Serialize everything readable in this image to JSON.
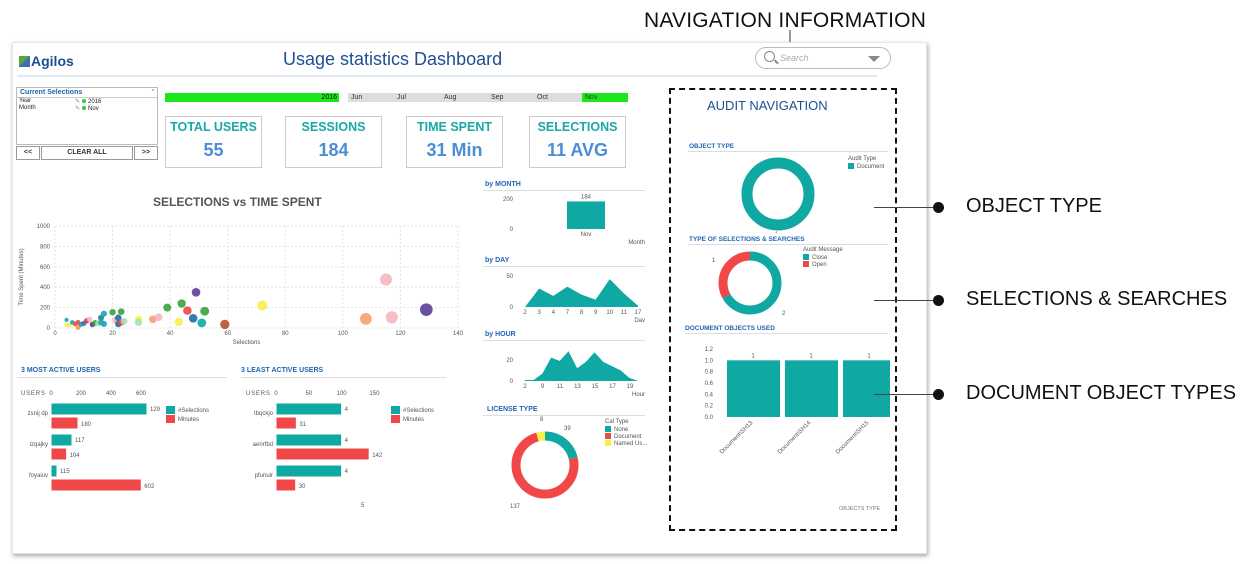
{
  "annotations": {
    "top": "NAVIGATION INFORMATION",
    "labels": [
      "OBJECT TYPE",
      "SELECTIONS & SEARCHES",
      "DOCUMENT OBJECT TYPES"
    ]
  },
  "header": {
    "logo": "Agilos",
    "title": "Usage  statistics Dashboard",
    "search_placeholder": "Search"
  },
  "current_selections": {
    "title": "Current Selections",
    "minimize": "-",
    "rows": [
      {
        "field": "Year",
        "value": "2016"
      },
      {
        "field": "Month",
        "value": "Nov"
      }
    ],
    "prev_label": "<<",
    "clear_label": "CLEAR ALL",
    "next_label": ">>"
  },
  "filters": {
    "year": "2016",
    "months": [
      "Jun",
      "Jul",
      "Aug",
      "Sep",
      "Oct",
      "Nov"
    ],
    "selected_month": "Nov"
  },
  "kpis": [
    {
      "label": "TOTAL USERS",
      "value": "55"
    },
    {
      "label": "SESSIONS",
      "value": "184"
    },
    {
      "label": "TIME SPENT",
      "value": "31 Min"
    },
    {
      "label": "SELECTIONS",
      "value": "11 AVG"
    }
  ],
  "colors": {
    "teal": "#0fa8a3",
    "red": "#f04848",
    "yellow": "#f5f04a",
    "title_blue": "#1e4f94",
    "section_blue": "#1e64b4",
    "kpi_label": "#19a8a8",
    "kpi_value": "#4a8ed6",
    "green_filter": "#1be81b"
  },
  "audit": {
    "title": "AUDIT NAVIGATION",
    "object_type_title": "OBJECT TYPE",
    "selections_title": "TYPE  OF  SELECTIONS  &  SEARCHES",
    "doc_objects_title": "DOCUMENT  OBJECTS  USED",
    "objects_type_xlabel": "OBJECTS TYPE"
  },
  "chart_data": [
    {
      "id": "scatter",
      "type": "scatter",
      "title": "SELECTIONS vs TIME SPENT",
      "xlabel": "Selections",
      "ylabel": "Time Spent (Minutes)",
      "xlim": [
        0,
        140
      ],
      "ylim": [
        0,
        1000
      ],
      "xticks": [
        0,
        20,
        40,
        60,
        80,
        100,
        120,
        140
      ],
      "yticks": [
        0,
        200,
        400,
        600,
        800,
        1000
      ],
      "grid": true,
      "points": [
        {
          "x": 4,
          "y": 80,
          "c": "#1aa7b8"
        },
        {
          "x": 4,
          "y": 30,
          "c": "#f5f04a"
        },
        {
          "x": 5,
          "y": 30,
          "c": "#f5f04a"
        },
        {
          "x": 6,
          "y": 55,
          "c": "#1aa7b8"
        },
        {
          "x": 7,
          "y": 40,
          "c": "#f04848"
        },
        {
          "x": 8,
          "y": 55,
          "c": "#f04848"
        },
        {
          "x": 8,
          "y": 5,
          "c": "#f29a5a"
        },
        {
          "x": 9,
          "y": 35,
          "c": "#1aa7b8"
        },
        {
          "x": 10,
          "y": 45,
          "c": "#3b6fb6"
        },
        {
          "x": 11,
          "y": 70,
          "c": "#d63a3a"
        },
        {
          "x": 12,
          "y": 85,
          "c": "#f7b6c2"
        },
        {
          "x": 13,
          "y": 35,
          "c": "#5b3f95"
        },
        {
          "x": 14,
          "y": 50,
          "c": "#3aa33a"
        },
        {
          "x": 15,
          "y": 45,
          "c": "#a5e0b5"
        },
        {
          "x": 16,
          "y": 100,
          "c": "#1f7fb0"
        },
        {
          "x": 16,
          "y": 55,
          "c": "#1aa7b8"
        },
        {
          "x": 17,
          "y": 140,
          "c": "#1aa7b8"
        },
        {
          "x": 17,
          "y": 40,
          "c": "#1aa7b8"
        },
        {
          "x": 20,
          "y": 155,
          "c": "#3aa33a"
        },
        {
          "x": 21,
          "y": 80,
          "c": "#f7b6c2"
        },
        {
          "x": 22,
          "y": 100,
          "c": "#1f6fa8"
        },
        {
          "x": 22,
          "y": 40,
          "c": "#1f6fa8"
        },
        {
          "x": 23,
          "y": 160,
          "c": "#3aa33a"
        },
        {
          "x": 23,
          "y": 55,
          "c": "#f04848"
        },
        {
          "x": 24,
          "y": 65,
          "c": "#a5e0b5"
        },
        {
          "x": 29,
          "y": 85,
          "c": "#f5f04a"
        },
        {
          "x": 29,
          "y": 55,
          "c": "#a5e0b5"
        },
        {
          "x": 34,
          "y": 85,
          "c": "#f7a070"
        },
        {
          "x": 36,
          "y": 105,
          "c": "#f7b6c2"
        },
        {
          "x": 39,
          "y": 200,
          "c": "#3aa33a"
        },
        {
          "x": 43,
          "y": 60,
          "c": "#f5f04a"
        },
        {
          "x": 44,
          "y": 240,
          "c": "#3aa33a"
        },
        {
          "x": 46,
          "y": 170,
          "c": "#f04848"
        },
        {
          "x": 48,
          "y": 95,
          "c": "#1f6fa8"
        },
        {
          "x": 49,
          "y": 350,
          "c": "#5b3f95"
        },
        {
          "x": 51,
          "y": 50,
          "c": "#0fa8a3"
        },
        {
          "x": 52,
          "y": 165,
          "c": "#3aa33a"
        },
        {
          "x": 59,
          "y": 35,
          "c": "#b5532a"
        },
        {
          "x": 72,
          "y": 220,
          "c": "#f5f04a"
        },
        {
          "x": 108,
          "y": 90,
          "c": "#f7a070"
        },
        {
          "x": 115,
          "y": 475,
          "c": "#f7b6c2"
        },
        {
          "x": 117,
          "y": 105,
          "c": "#f7b6c2"
        },
        {
          "x": 129,
          "y": 180,
          "c": "#5b3f95"
        }
      ]
    },
    {
      "id": "most_active",
      "type": "bar",
      "title": "3 MOST ACTIVE USERS",
      "ylabel": "USERS",
      "xticks": [
        0,
        200,
        400,
        600
      ],
      "xlim": [
        0,
        700
      ],
      "categories": [
        "zsnij dp",
        "izqajky",
        "foyaiuv"
      ],
      "series": [
        {
          "name": "#Selections",
          "values": [
            129,
            117,
            115
          ],
          "bar_lengths": [
            640,
            140,
            40
          ]
        },
        {
          "name": "Minutes",
          "values": [
            180,
            104,
            602
          ]
        }
      ]
    },
    {
      "id": "least_active",
      "type": "bar",
      "title": "3 LEAST ACTIVE USERS",
      "ylabel": "USERS",
      "xticks": [
        0,
        50,
        100,
        150
      ],
      "xlim": [
        0,
        160
      ],
      "categories": [
        "tbqckjo",
        "aenrfbd",
        "pfunuir"
      ],
      "series": [
        {
          "name": "#Selections",
          "values": [
            4,
            4,
            4
          ],
          "bar_lengths": [
            100,
            100,
            100
          ]
        },
        {
          "name": "Minutes",
          "values": [
            31,
            142,
            30
          ]
        }
      ],
      "footnote": "5"
    },
    {
      "id": "by_month",
      "type": "bar",
      "title": "by MONTH",
      "xlabel": "Month",
      "categories": [
        "Nov"
      ],
      "values": [
        184
      ],
      "yticks": [
        0,
        200
      ],
      "ylim": [
        0,
        220
      ]
    },
    {
      "id": "by_day",
      "type": "area",
      "title": "by DAY",
      "xlabel": "Day",
      "x": [
        "2",
        "3",
        "4",
        "7",
        "8",
        "9",
        "10",
        "11",
        "17"
      ],
      "values": [
        0,
        30,
        18,
        33,
        20,
        12,
        45,
        22,
        2
      ],
      "yticks": [
        0,
        50
      ],
      "ylim": [
        0,
        55
      ]
    },
    {
      "id": "by_hour",
      "type": "area",
      "title": "by HOUR",
      "xlabel": "Hour",
      "x": [
        "2",
        "",
        "",
        "9",
        "",
        "11",
        "",
        "13",
        "",
        "15",
        "",
        "17",
        "",
        "19",
        ""
      ],
      "tick_labels": [
        "2",
        "9",
        "11",
        "13",
        "15",
        "17",
        "19"
      ],
      "values": [
        1,
        1,
        7,
        22,
        19,
        28,
        12,
        18,
        27,
        18,
        14,
        10,
        3,
        0
      ],
      "yticks": [
        0,
        20
      ],
      "ylim": [
        0,
        32
      ]
    },
    {
      "id": "license_type",
      "type": "pie",
      "title": "LICENSE TYPE",
      "legend_title": "Cal Type",
      "labels": [
        "None",
        "Document",
        "Named Us..."
      ],
      "values": [
        39,
        137,
        8
      ],
      "colors": [
        "#0fa8a3",
        "#f04848",
        "#f5f04a"
      ]
    },
    {
      "id": "object_type",
      "type": "pie",
      "title": "OBJECT TYPE",
      "legend_title": "Audit Type",
      "labels": [
        "Document"
      ],
      "values": [
        1
      ],
      "colors": [
        "#0fa8a3"
      ]
    },
    {
      "id": "selections_searches",
      "type": "pie",
      "title": "TYPE  OF  SELECTIONS  &  SEARCHES",
      "legend_title": "Audit Message",
      "labels": [
        "Close",
        "Open"
      ],
      "values": [
        2,
        1
      ],
      "colors": [
        "#0fa8a3",
        "#f04848"
      ]
    },
    {
      "id": "document_objects",
      "type": "bar",
      "title": "DOCUMENT  OBJECTS  USED",
      "xlabel": "OBJECTS TYPE",
      "categories": [
        "Document\\SH13",
        "Document\\SH14",
        "Document\\SH15"
      ],
      "values": [
        1,
        1,
        1
      ],
      "yticks": [
        "0.0",
        "0.2",
        "0.4",
        "0.6",
        "0.8",
        "1.0",
        "1.2"
      ],
      "ylim": [
        0,
        1.2
      ]
    }
  ]
}
